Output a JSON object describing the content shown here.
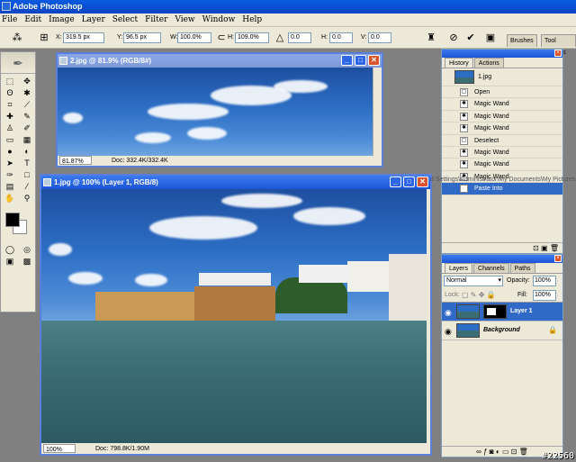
{
  "app": {
    "title": "Adobe Photoshop"
  },
  "menu": [
    "File",
    "Edit",
    "Image",
    "Layer",
    "Select",
    "Filter",
    "View",
    "Window",
    "Help"
  ],
  "options": {
    "x_label": "X:",
    "x_value": "319.5 px",
    "y_label": "Y:",
    "y_value": "96.5 px",
    "w_label": "W:",
    "w_value": "100.0%",
    "h_label": "H:",
    "h_value": "109.0%",
    "rot_value": "0.0",
    "hskew_label": "H:",
    "hskew_value": "0.0",
    "vskew_label": "V:",
    "vskew_value": "0.0",
    "tabs": [
      "Brushes",
      "Tool Presets"
    ]
  },
  "doc2": {
    "title": "2.jpg @ 81.9% (RGB/8#)",
    "zoom": "81.87%",
    "docinfo": "Doc: 332.4K/332.4K"
  },
  "doc1": {
    "title": "1.jpg @ 100% (Layer 1, RGB/8)",
    "zoom": "100%",
    "docinfo": "Doc: 798.8K/1.90M"
  },
  "history": {
    "tabs": [
      "History",
      "Actions"
    ],
    "snapshot": "1.jpg",
    "items": [
      "Open",
      "Magic Wand",
      "Magic Wand",
      "Magic Wand",
      "Deselect",
      "Magic Wand",
      "Magic Wand",
      "Magic Wand",
      "Paste Into"
    ],
    "selected_index": 8,
    "ghost_text": "d Settings\\Administrator\\My Documents\\My Pictures"
  },
  "layers": {
    "tabs": [
      "Layers",
      "Channels",
      "Paths"
    ],
    "blend_mode": "Normal",
    "opacity_label": "Opacity:",
    "opacity": "100%",
    "lock_label": "Lock:",
    "fill_label": "Fill:",
    "fill": "100%",
    "items": [
      {
        "name": "Layer 1",
        "selected": true
      },
      {
        "name": "Background",
        "selected": false
      }
    ]
  },
  "watermark": "#22560"
}
